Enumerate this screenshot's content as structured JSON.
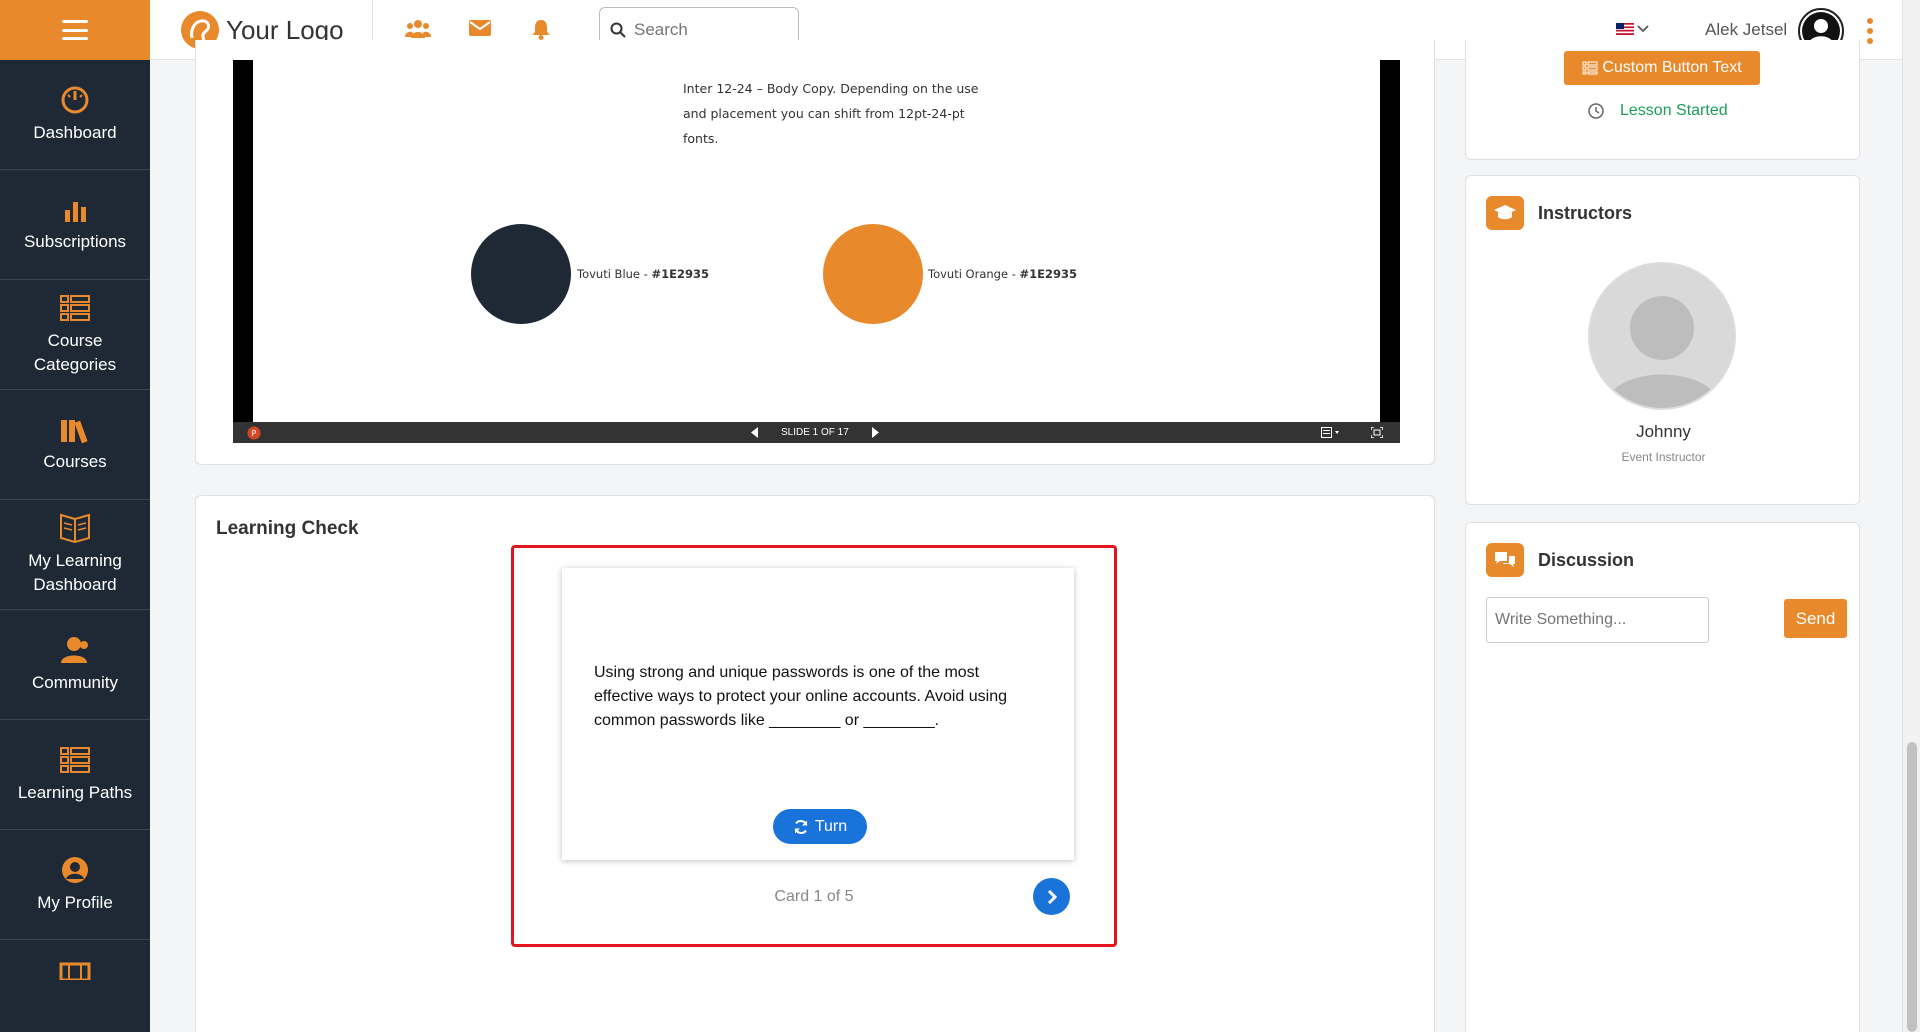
{
  "colors": {
    "accent": "#e8892c",
    "sidebar_bg": "#1e2935",
    "primary_blue": "#1a73d9",
    "highlight_red": "#e3141c",
    "success_green": "#1a9e5a"
  },
  "sidebar": {
    "items": [
      {
        "label": "Dashboard",
        "icon": "gauge-icon"
      },
      {
        "label": "Subscriptions",
        "icon": "bar-chart-icon"
      },
      {
        "label": "Course Categories",
        "icon": "list-icon"
      },
      {
        "label": "Courses",
        "icon": "books-icon"
      },
      {
        "label": "My Learning Dashboard",
        "icon": "open-book-icon"
      },
      {
        "label": "Community",
        "icon": "user-group-icon"
      },
      {
        "label": "Learning Paths",
        "icon": "list-icon"
      },
      {
        "label": "My Profile",
        "icon": "user-circle-icon"
      }
    ]
  },
  "header": {
    "logo_text": "Your Logo",
    "search_placeholder": "Search",
    "user_name": "Alek Jetsel"
  },
  "slide": {
    "body_text": "Inter 12-24 – Body Copy. Depending on the use and placement you can shift from 12pt-24-pt fonts.",
    "swatches": [
      {
        "label": "Tovuti Blue - ",
        "code": "#1E2935",
        "color": "#1e2935"
      },
      {
        "label": "Tovuti Orange - ",
        "code": "#1E2935",
        "color": "#e8892c"
      }
    ],
    "counter": "SLIDE 1 OF 17"
  },
  "learning_check": {
    "title": "Learning Check",
    "card_text": "Using strong and unique passwords is one of the most effective ways to protect your online accounts. Avoid using common passwords like ________ or ________.",
    "turn_label": "Turn",
    "card_counter": "Card 1 of 5"
  },
  "lesson": {
    "custom_button": "Custom Button Text",
    "status": "Lesson Started"
  },
  "instructors": {
    "title": "Instructors",
    "name": "Johnny",
    "role": "Event Instructor"
  },
  "discussion": {
    "title": "Discussion",
    "input_placeholder": "Write Something...",
    "send_label": "Send"
  }
}
